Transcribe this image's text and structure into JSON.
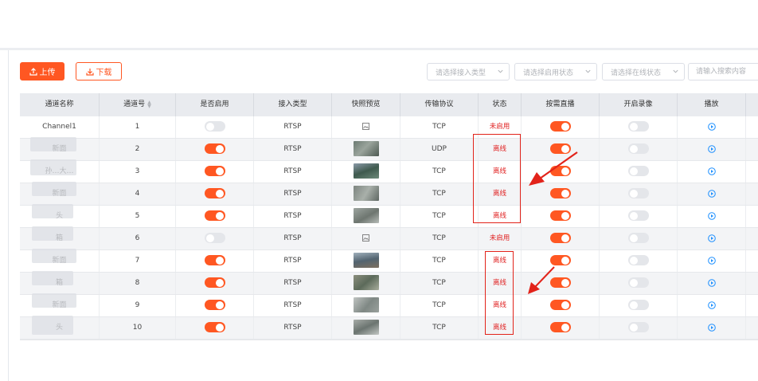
{
  "toolbar": {
    "upload_label": "上传",
    "download_label": "下载",
    "filters": [
      {
        "placeholder": "请选择接入类型"
      },
      {
        "placeholder": "请选择启用状态"
      },
      {
        "placeholder": "请选择在线状态"
      }
    ],
    "search_placeholder": "请输入搜索内容"
  },
  "table": {
    "headers": [
      "通道名称",
      "通道号",
      "是否启用",
      "接入类型",
      "快照预览",
      "传输协议",
      "状态",
      "按需直播",
      "开启录像",
      "播放"
    ],
    "rows": [
      {
        "name": "Channel1",
        "no": "1",
        "enabled": false,
        "access": "RTSP",
        "snapshot": "none",
        "protocol": "TCP",
        "status": "未启用",
        "ondemand": true,
        "record": false
      },
      {
        "name": "新面",
        "no": "2",
        "enabled": true,
        "access": "RTSP",
        "snapshot": "image",
        "protocol": "UDP",
        "status": "离线",
        "ondemand": true,
        "record": false
      },
      {
        "name": "孙…大…",
        "no": "3",
        "enabled": true,
        "access": "RTSP",
        "snapshot": "image",
        "protocol": "TCP",
        "status": "离线",
        "ondemand": true,
        "record": false
      },
      {
        "name": "新面",
        "no": "4",
        "enabled": true,
        "access": "RTSP",
        "snapshot": "image",
        "protocol": "TCP",
        "status": "离线",
        "ondemand": true,
        "record": false
      },
      {
        "name": "头",
        "no": "5",
        "enabled": true,
        "access": "RTSP",
        "snapshot": "image",
        "protocol": "TCP",
        "status": "离线",
        "ondemand": true,
        "record": false
      },
      {
        "name": "箱",
        "no": "6",
        "enabled": false,
        "access": "RTSP",
        "snapshot": "none",
        "protocol": "TCP",
        "status": "未启用",
        "ondemand": true,
        "record": false
      },
      {
        "name": "新面",
        "no": "7",
        "enabled": true,
        "access": "RTSP",
        "snapshot": "image",
        "protocol": "TCP",
        "status": "离线",
        "ondemand": true,
        "record": false
      },
      {
        "name": "箱",
        "no": "8",
        "enabled": true,
        "access": "RTSP",
        "snapshot": "image",
        "protocol": "TCP",
        "status": "离线",
        "ondemand": true,
        "record": false
      },
      {
        "name": "新面",
        "no": "9",
        "enabled": true,
        "access": "RTSP",
        "snapshot": "image",
        "protocol": "TCP",
        "status": "离线",
        "ondemand": true,
        "record": false
      },
      {
        "name": "头",
        "no": "10",
        "enabled": true,
        "access": "RTSP",
        "snapshot": "image",
        "protocol": "TCP",
        "status": "离线",
        "ondemand": true,
        "record": false
      }
    ]
  },
  "colors": {
    "accent": "#ff5722",
    "status_red": "#e02020",
    "play_blue": "#1e90ff",
    "annotation_red": "#e2231a"
  },
  "icons": {
    "upload": "upload-icon",
    "download": "download-icon",
    "chevron": "chevron-down-icon",
    "sort": "sort-icon",
    "image_placeholder": "image-placeholder-icon",
    "play": "play-circle-icon"
  }
}
